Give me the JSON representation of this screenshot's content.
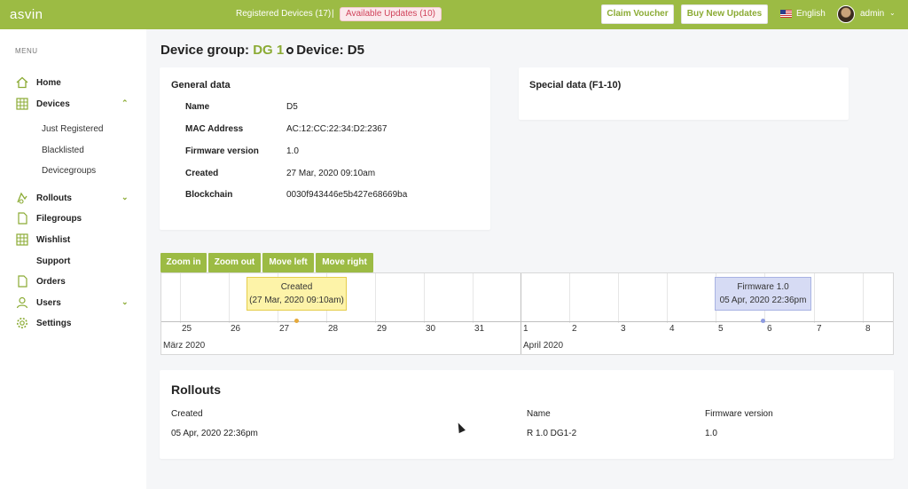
{
  "header": {
    "brand": "asvin",
    "registered_devices": "Registered Devices (17)",
    "separator": "|",
    "available_updates": "Available Updates (10)",
    "claim_voucher": "Claim Voucher",
    "buy_new_updates": "Buy New Updates",
    "language": "English",
    "user": "admin"
  },
  "sidebar": {
    "menu_label": "MENU",
    "items": [
      {
        "label": "Home",
        "icon": "home-icon"
      },
      {
        "label": "Devices",
        "icon": "grid-icon",
        "expanded": true
      },
      {
        "label": "Rollouts",
        "icon": "rollout-icon"
      },
      {
        "label": "Filegroups",
        "icon": "file-icon"
      },
      {
        "label": "Wishlist",
        "icon": "grid-icon"
      },
      {
        "label": "Support",
        "icon": ""
      },
      {
        "label": "Orders",
        "icon": "file-icon"
      },
      {
        "label": "Users",
        "icon": "user-icon"
      },
      {
        "label": "Settings",
        "icon": "gear-icon"
      }
    ],
    "device_subitems": [
      "Just Registered",
      "Blacklisted",
      "Devicegroups"
    ]
  },
  "page": {
    "title_prefix": "Device group: ",
    "group": "DG 1",
    "title_device": "Device: D5"
  },
  "general": {
    "title": "General data",
    "rows": [
      {
        "key": "Name",
        "value": "D5"
      },
      {
        "key": "MAC Address",
        "value": "AC:12:CC:22:34:D2:2367"
      },
      {
        "key": "Firmware version",
        "value": "1.0"
      },
      {
        "key": "Created",
        "value": "27 Mar, 2020 09:10am"
      },
      {
        "key": "Blockchain",
        "value": "0030f943446e5b427e68669ba"
      }
    ]
  },
  "special": {
    "title": "Special data (F1-10)"
  },
  "timeline": {
    "buttons": [
      "Zoom in",
      "Zoom out",
      "Move left",
      "Move right"
    ],
    "days": [
      "25",
      "26",
      "27",
      "28",
      "29",
      "30",
      "31",
      "1",
      "2",
      "3",
      "4",
      "5",
      "6",
      "7",
      "8"
    ],
    "months": [
      "März 2020",
      "April 2020"
    ],
    "events": [
      {
        "line1": "Created",
        "line2": "(27 Mar, 2020 09:10am)",
        "color": "#e5a93b"
      },
      {
        "line1": "Firmware 1.0",
        "line2": "05 Apr, 2020 22:36pm",
        "color": "#8e9be0"
      }
    ]
  },
  "rollouts": {
    "title": "Rollouts",
    "columns": [
      "Created",
      "Name",
      "Firmware version"
    ],
    "rows": [
      [
        "05 Apr, 2020 22:36pm",
        "R 1.0 DG1-2",
        "1.0"
      ]
    ]
  },
  "colors": {
    "brand": "#9cbb44",
    "accent": "#8bab34",
    "alert": "#d0435b"
  }
}
